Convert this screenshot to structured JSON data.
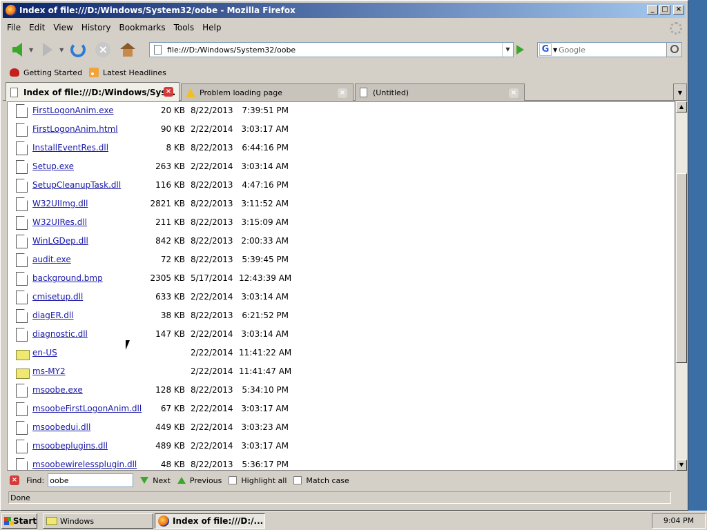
{
  "window": {
    "title": "Index of file:///D:/Windows/System32/oobe - Mozilla Firefox",
    "min": "_",
    "max": "□",
    "close": "×"
  },
  "menu": [
    "File",
    "Edit",
    "View",
    "History",
    "Bookmarks",
    "Tools",
    "Help"
  ],
  "nav": {
    "url": "file:///D:/Windows/System32/oobe",
    "search_placeholder": "Google",
    "search_engine": "G"
  },
  "bookmarks": [
    "Getting Started",
    "Latest Headlines"
  ],
  "tabs": [
    {
      "label": "Index of file:///D:/Windows/Sys...",
      "active": true
    },
    {
      "label": "Problem loading page",
      "active": false
    },
    {
      "label": "(Untitled)",
      "active": false
    }
  ],
  "files": [
    {
      "name": "FirstLogonAnim.exe",
      "size": "20 KB",
      "date": "8/22/2013",
      "time": "7:39:51 PM",
      "type": "file"
    },
    {
      "name": "FirstLogonAnim.html",
      "size": "90 KB",
      "date": "2/22/2014",
      "time": "3:03:17 AM",
      "type": "file"
    },
    {
      "name": "InstallEventRes.dll",
      "size": "8 KB",
      "date": "8/22/2013",
      "time": "6:44:16 PM",
      "type": "file"
    },
    {
      "name": "Setup.exe",
      "size": "263 KB",
      "date": "2/22/2014",
      "time": "3:03:14 AM",
      "type": "file"
    },
    {
      "name": "SetupCleanupTask.dll",
      "size": "116 KB",
      "date": "8/22/2013",
      "time": "4:47:16 PM",
      "type": "file"
    },
    {
      "name": "W32UIImg.dll",
      "size": "2821 KB",
      "date": "8/22/2013",
      "time": "3:11:52 AM",
      "type": "file"
    },
    {
      "name": "W32UIRes.dll",
      "size": "211 KB",
      "date": "8/22/2013",
      "time": "3:15:09 AM",
      "type": "file"
    },
    {
      "name": "WinLGDep.dll",
      "size": "842 KB",
      "date": "8/22/2013",
      "time": "2:00:33 AM",
      "type": "file"
    },
    {
      "name": "audit.exe",
      "size": "72 KB",
      "date": "8/22/2013",
      "time": "5:39:45 PM",
      "type": "file"
    },
    {
      "name": "background.bmp",
      "size": "2305 KB",
      "date": "5/17/2014",
      "time": "12:43:39 AM",
      "type": "file"
    },
    {
      "name": "cmisetup.dll",
      "size": "633 KB",
      "date": "2/22/2014",
      "time": "3:03:14 AM",
      "type": "file"
    },
    {
      "name": "diagER.dll",
      "size": "38 KB",
      "date": "8/22/2013",
      "time": "6:21:52 PM",
      "type": "file"
    },
    {
      "name": "diagnostic.dll",
      "size": "147 KB",
      "date": "2/22/2014",
      "time": "3:03:14 AM",
      "type": "file"
    },
    {
      "name": "en-US",
      "size": "",
      "date": "2/22/2014",
      "time": "11:41:22 AM",
      "type": "folder"
    },
    {
      "name": "ms-MY2",
      "size": "",
      "date": "2/22/2014",
      "time": "11:41:47 AM",
      "type": "folder"
    },
    {
      "name": "msoobe.exe",
      "size": "128 KB",
      "date": "8/22/2013",
      "time": "5:34:10 PM",
      "type": "file"
    },
    {
      "name": "msoobeFirstLogonAnim.dll",
      "size": "67 KB",
      "date": "2/22/2014",
      "time": "3:03:17 AM",
      "type": "file"
    },
    {
      "name": "msoobedui.dll",
      "size": "449 KB",
      "date": "2/22/2014",
      "time": "3:03:23 AM",
      "type": "file"
    },
    {
      "name": "msoobeplugins.dll",
      "size": "489 KB",
      "date": "2/22/2014",
      "time": "3:03:17 AM",
      "type": "file"
    },
    {
      "name": "msoobewirelessplugin.dll",
      "size": "48 KB",
      "date": "8/22/2013",
      "time": "5:36:17 PM",
      "type": "file"
    }
  ],
  "find": {
    "label": "Find:",
    "value": "oobe",
    "next": "Next",
    "previous": "Previous",
    "highlight": "Highlight all",
    "match_case": "Match case"
  },
  "status": "Done",
  "taskbar": {
    "start": "Start",
    "tasks": [
      "Windows",
      "Index of file:///D:/..."
    ],
    "clock": "9:04 PM"
  }
}
